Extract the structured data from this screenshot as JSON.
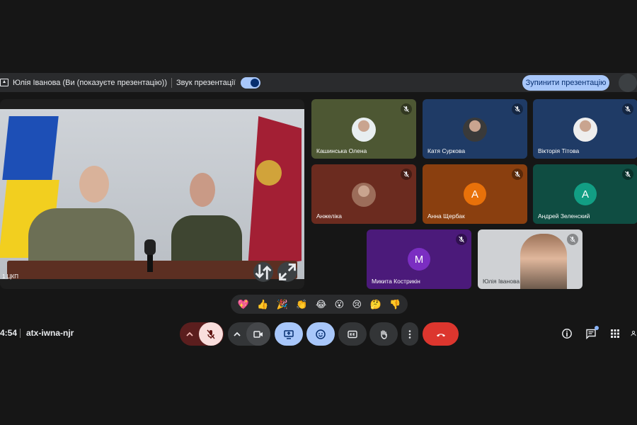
{
  "presentation_bar": {
    "presenter_text": "Юлія Іванова (Ви (показуєте презентацію))",
    "audio_label": "Звук презентації",
    "stop_label": "Зупинити презентацію"
  },
  "main_video": {
    "caption": "1 ЦКП"
  },
  "participants": [
    {
      "name": "Кашинська Олена",
      "bg": "#4d5733",
      "muted": true,
      "avatar": "photo"
    },
    {
      "name": "Катя Суркова",
      "bg": "#1f3b66",
      "muted": true,
      "avatar": "photo"
    },
    {
      "name": "Вікторія Тітова",
      "bg": "#1f3b66",
      "muted": true,
      "avatar": "photo"
    },
    {
      "name": "Анжеліка",
      "bg": "#6b2b1f",
      "muted": true,
      "avatar": "photo"
    },
    {
      "name": "Анна Щербак",
      "bg": "#8a3f0f",
      "muted": true,
      "avatar": "letter",
      "letter": "А",
      "letter_bg": "#e8710a"
    },
    {
      "name": "Андрей Зеленский",
      "bg": "#0f4d42",
      "muted": true,
      "avatar": "letter",
      "letter": "А",
      "letter_bg": "#129e84"
    },
    {
      "name": "Микита Кострикін",
      "bg": "#4b1a7a",
      "muted": true,
      "avatar": "letter",
      "letter": "M",
      "letter_bg": "#7b2ec2"
    },
    {
      "name": "Юлія Іванова",
      "bg": "#cfd1d4",
      "muted": true,
      "avatar": "self"
    }
  ],
  "reactions": [
    "💖",
    "👍",
    "🎉",
    "👏",
    "😂",
    "😮",
    "😢",
    "🤔",
    "👎"
  ],
  "meeting": {
    "time": "4:54",
    "code": "atx-iwna-njr"
  },
  "colors": {
    "background": "#161616",
    "accent": "#a8c7fa",
    "danger": "#dc362e"
  }
}
